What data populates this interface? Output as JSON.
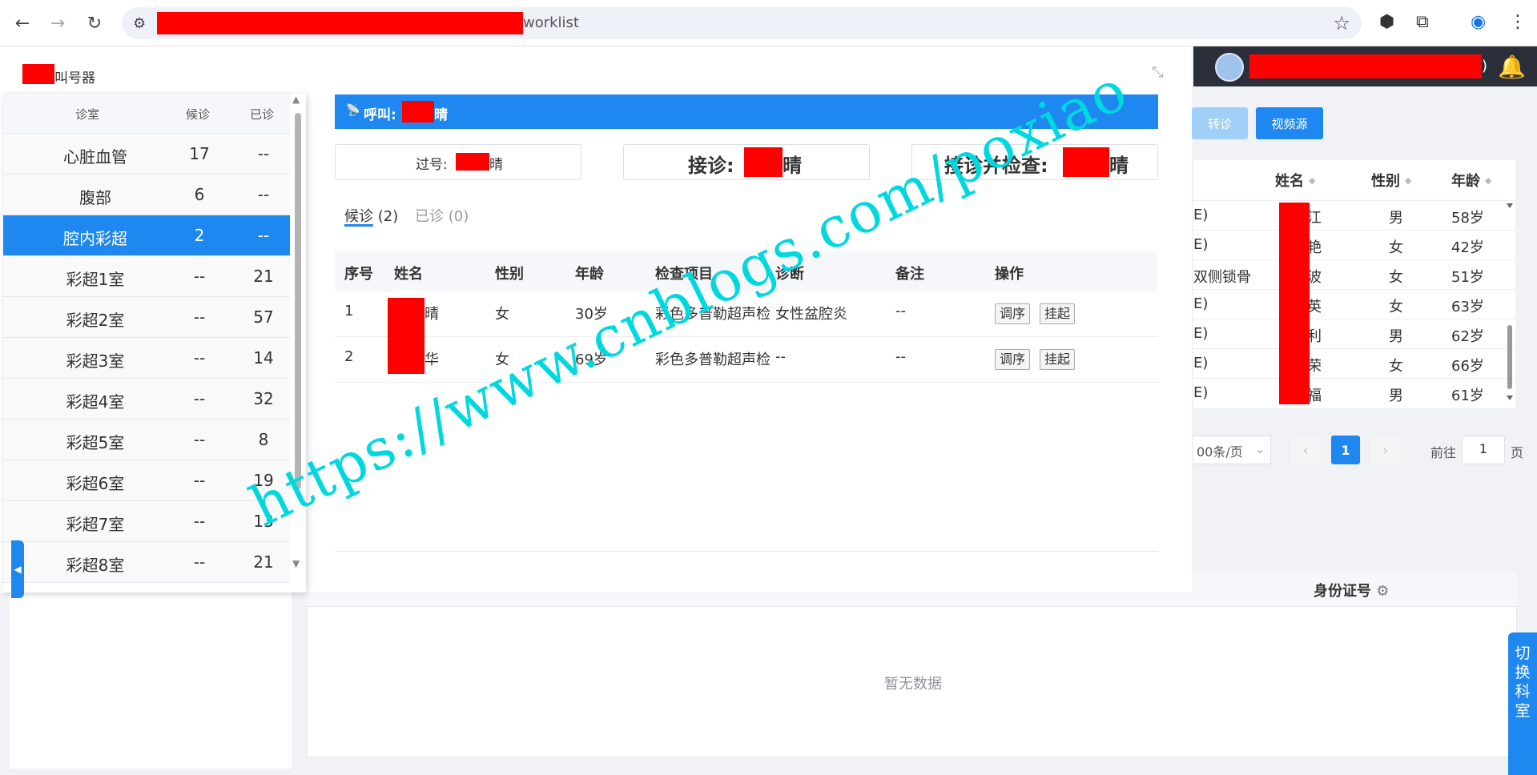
{
  "browser": {
    "url_suffix": "worklist"
  },
  "header": {
    "paren": ")"
  },
  "toolbar": {
    "transfer_label": "转诊",
    "video_source_label": "视频源"
  },
  "bg_table": {
    "columns": [
      "姓名",
      "性别",
      "年龄"
    ],
    "rows": [
      {
        "prefix": "E)",
        "name": "江",
        "sex": "男",
        "age": "58岁"
      },
      {
        "prefix": "E)",
        "name": "艳",
        "sex": "女",
        "age": "42岁"
      },
      {
        "prefix": "双侧锁骨",
        "name": "波",
        "sex": "女",
        "age": "51岁"
      },
      {
        "prefix": "E)",
        "name": "英",
        "sex": "女",
        "age": "63岁"
      },
      {
        "prefix": "E)",
        "name": "利",
        "sex": "男",
        "age": "62岁"
      },
      {
        "prefix": "E)",
        "name": "荣",
        "sex": "女",
        "age": "66岁"
      },
      {
        "prefix": "E)",
        "name": "福",
        "sex": "男",
        "age": "61岁"
      }
    ]
  },
  "pager": {
    "page_size": "00条/页",
    "current_page": "1",
    "goto_prefix": "前往",
    "goto_value": "1",
    "goto_suffix": "页"
  },
  "bottom_table": {
    "id_column": "身份证号",
    "empty_text": "暂无数据"
  },
  "side_tab": {
    "label": "切换科室"
  },
  "modal": {
    "title": "叫号器",
    "call_label": "呼叫:",
    "call_name": "晴",
    "pass_label": "过号:",
    "pass_name": "晴",
    "accept_label": "接诊:",
    "accept_name": "晴",
    "accept_check_label": "接诊并检查:",
    "accept_check_name": "晴",
    "tabs": {
      "waiting": "候诊",
      "waiting_count": "(2)",
      "done": "已诊",
      "done_count": "(0)"
    },
    "columns": [
      "序号",
      "姓名",
      "性别",
      "年龄",
      "检查项目",
      "诊断",
      "备注",
      "操作"
    ],
    "rows": [
      {
        "no": "1",
        "name": "晴",
        "sex": "女",
        "age": "30岁",
        "exam": "彩色多普勒超声检",
        "diag": "女性盆腔炎",
        "note": "--"
      },
      {
        "no": "2",
        "name": "华",
        "sex": "女",
        "age": "69岁",
        "exam": "彩色多普勒超声检",
        "diag": "--",
        "note": "--"
      }
    ],
    "reorder_label": "调序",
    "hangup_label": "挂起"
  },
  "rooms": {
    "columns": [
      "诊室",
      "候诊",
      "已诊"
    ],
    "items": [
      {
        "name": "心脏血管",
        "waiting": "17",
        "done": "--"
      },
      {
        "name": "腹部",
        "waiting": "6",
        "done": "--"
      },
      {
        "name": "腔内彩超",
        "waiting": "2",
        "done": "--"
      },
      {
        "name": "彩超1室",
        "waiting": "--",
        "done": "21"
      },
      {
        "name": "彩超2室",
        "waiting": "--",
        "done": "57"
      },
      {
        "name": "彩超3室",
        "waiting": "--",
        "done": "14"
      },
      {
        "name": "彩超4室",
        "waiting": "--",
        "done": "32"
      },
      {
        "name": "彩超5室",
        "waiting": "--",
        "done": "8"
      },
      {
        "name": "彩超6室",
        "waiting": "--",
        "done": "19"
      },
      {
        "name": "彩超7室",
        "waiting": "--",
        "done": "13"
      },
      {
        "name": "彩超8室",
        "waiting": "--",
        "done": "21"
      }
    ]
  },
  "watermark": "https://www.cnblogs.com/poxiao",
  "colors": {
    "accent": "#1e88f0",
    "redaction": "#ff0000",
    "header_bg": "#2b2f3a"
  }
}
